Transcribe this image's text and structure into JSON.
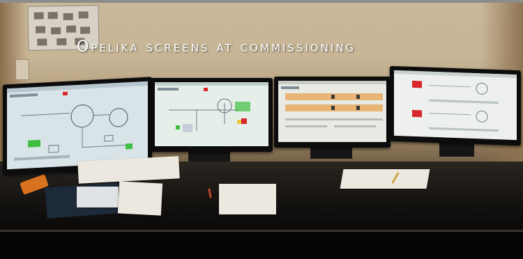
{
  "caption": "Opelika screens at commissioning",
  "monitors": [
    {
      "name": "monitor-1",
      "screen_color": "#d9e4e8"
    },
    {
      "name": "monitor-2",
      "screen_color": "#e6eee9"
    },
    {
      "name": "monitor-3",
      "screen_color": "#e9eae4"
    },
    {
      "name": "monitor-4",
      "screen_color": "#edf0ee"
    }
  ],
  "colors": {
    "wall": "#c7b596",
    "desk": "#141210",
    "caption_text": "#ffffff",
    "alarm_red": "#d8262b",
    "status_green": "#3fbf3f",
    "highlight_orange": "#e7a85a"
  }
}
